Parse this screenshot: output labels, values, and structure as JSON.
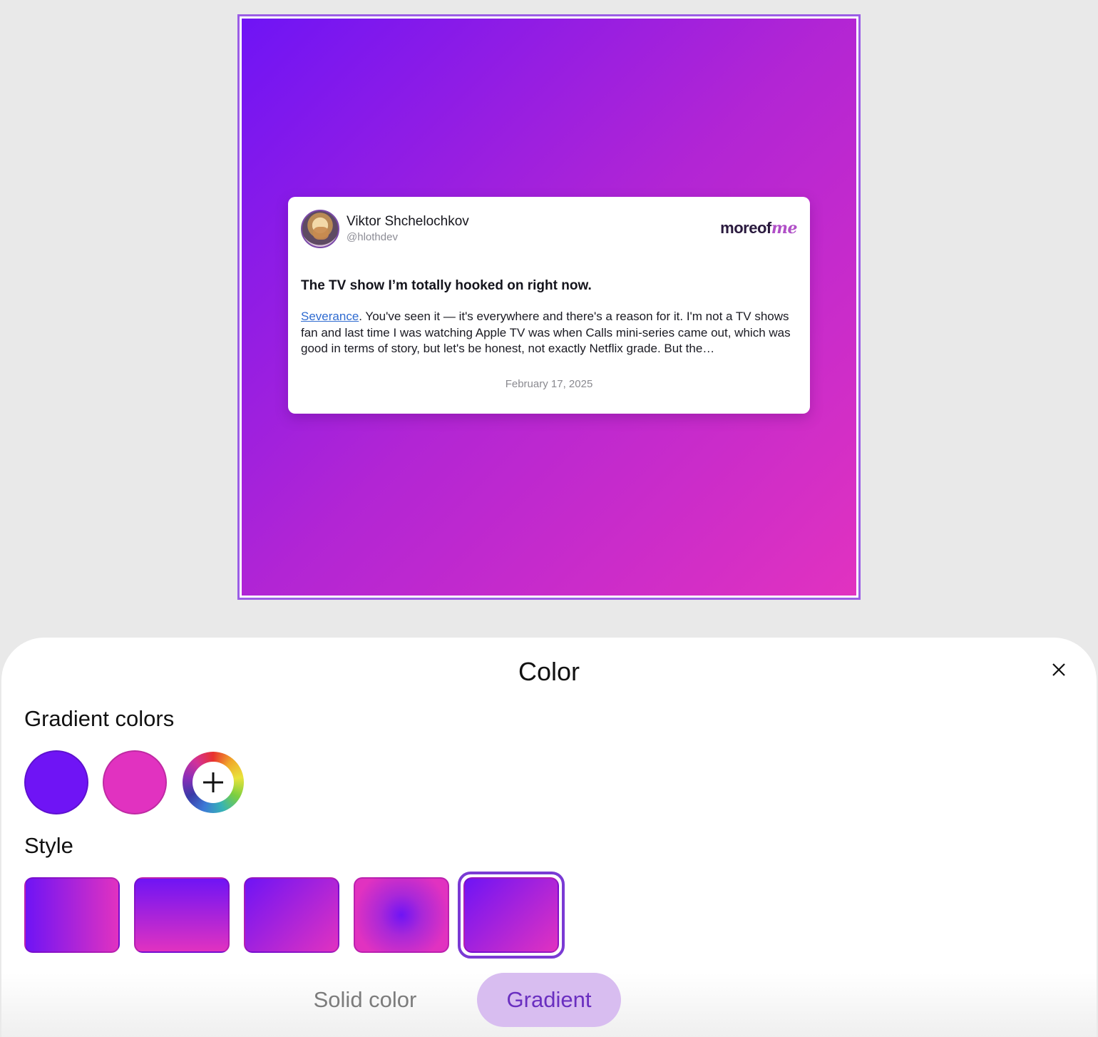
{
  "preview": {
    "gradient_colors": [
      "#6f14f5",
      "#e132c0"
    ],
    "card": {
      "author_name": "Viktor Shchelochkov",
      "author_handle": "@hlothdev",
      "brand_text_1": "moreof",
      "brand_text_2": "me",
      "title": "The TV show I’m totally hooked on right now.",
      "body_link": "Severance",
      "body_text": ". You've seen it — it's everywhere and there's a reason for it. I'm not a TV shows fan and last time I was watching Apple TV was when Calls mini-series came out, which was good in terms of story, but let's be honest, not exactly Netflix grade. But the…",
      "date": "February 17, 2025"
    }
  },
  "sheet": {
    "title": "Color",
    "close_icon": "close-icon",
    "gradient_colors_label": "Gradient colors",
    "swatches": [
      "#6f14f5",
      "#e132c0"
    ],
    "add_color_icon": "plus-icon",
    "style_label": "Style",
    "styles": [
      "linear-horizontal",
      "linear-vertical",
      "linear-diagonal",
      "radial",
      "linear-diagonal-alt"
    ],
    "selected_style_index": 4,
    "mode_solid": "Solid color",
    "mode_gradient": "Gradient",
    "active_mode": "Gradient",
    "accent_color": "#7a3ad4"
  }
}
